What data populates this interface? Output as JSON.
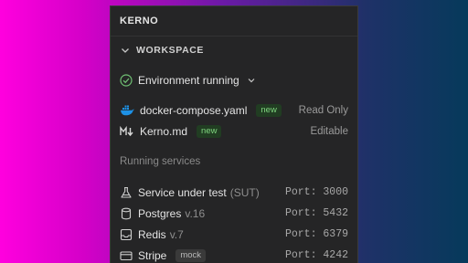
{
  "panel": {
    "title": "KERNO"
  },
  "workspace": {
    "label": "WORKSPACE",
    "status": "Environment running"
  },
  "files": [
    {
      "name": "docker-compose.yaml",
      "badge": "new",
      "mode": "Read Only",
      "icon": "docker-icon"
    },
    {
      "name": "Kerno.md",
      "badge": "new",
      "mode": "Editable",
      "icon": "markdown-icon"
    }
  ],
  "services_heading": "Running services",
  "services": [
    {
      "name": "Service under test",
      "detail": "(SUT)",
      "port_label": "Port:",
      "port": "3000",
      "icon": "flask-icon"
    },
    {
      "name": "Postgres",
      "detail": "v.16",
      "port_label": "Port:",
      "port": "5432",
      "icon": "database-icon"
    },
    {
      "name": "Redis",
      "detail": "v.7",
      "port_label": "Port:",
      "port": "6379",
      "icon": "inbox-icon"
    },
    {
      "name": "Stripe",
      "badge": "mock",
      "port_label": "Port:",
      "port": "4242",
      "icon": "card-icon"
    }
  ],
  "colors": {
    "panel_bg": "#252526",
    "status_green": "#6fbf73",
    "docker_blue": "#1d91e6",
    "badge_new_bg": "#213d22",
    "badge_new_fg": "#7fd67f"
  }
}
